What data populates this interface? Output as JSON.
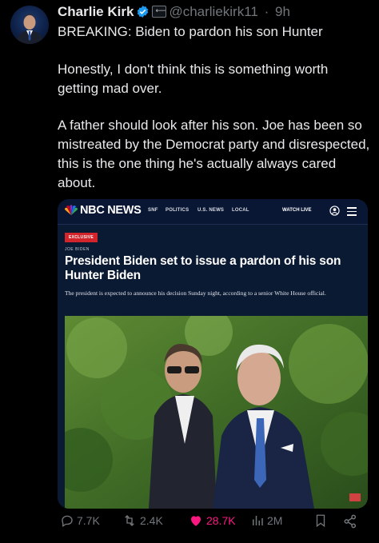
{
  "author": {
    "display_name": "Charlie Kirk",
    "handle": "@charliekirk11",
    "separator": "·",
    "time": "9h",
    "affiliation_badge": "TPUSA"
  },
  "tweet": {
    "paragraphs": [
      "BREAKING: Biden to pardon his son Hunter",
      "Honestly, I don't think this is something worth getting mad over.",
      "A father should look after his son. Joe has been so mistreated by the Democrat party and disrespected, this is the one thing he's actually always cared about."
    ]
  },
  "card": {
    "brand": "NBC NEWS",
    "nav": [
      "SNF",
      "POLITICS",
      "U.S. NEWS",
      "LOCAL"
    ],
    "watch_live": "WATCH LIVE",
    "label": "EXCLUSIVE",
    "category": "JOE BIDEN",
    "headline": "President Biden set to issue a pardon of his son Hunter Biden",
    "dek": "The president is expected to announce his decision Sunday night, according to a senior White House official."
  },
  "actions": {
    "replies": "7.7K",
    "reposts": "2.4K",
    "likes": "28.7K",
    "views": "2M"
  },
  "colors": {
    "background": "#000000",
    "text": "#e7e9ea",
    "muted": "#71767b",
    "verified": "#1d9bf0",
    "like": "#f91880",
    "nbc_navy": "#0a1734",
    "exclusive_red": "#d1242b"
  },
  "icons": [
    "verified-badge-icon",
    "affiliation-badge-icon",
    "nbc-peacock-icon",
    "account-icon",
    "menu-icon",
    "reply-icon",
    "repost-icon",
    "like-icon",
    "views-icon",
    "bookmark-icon",
    "share-icon"
  ]
}
